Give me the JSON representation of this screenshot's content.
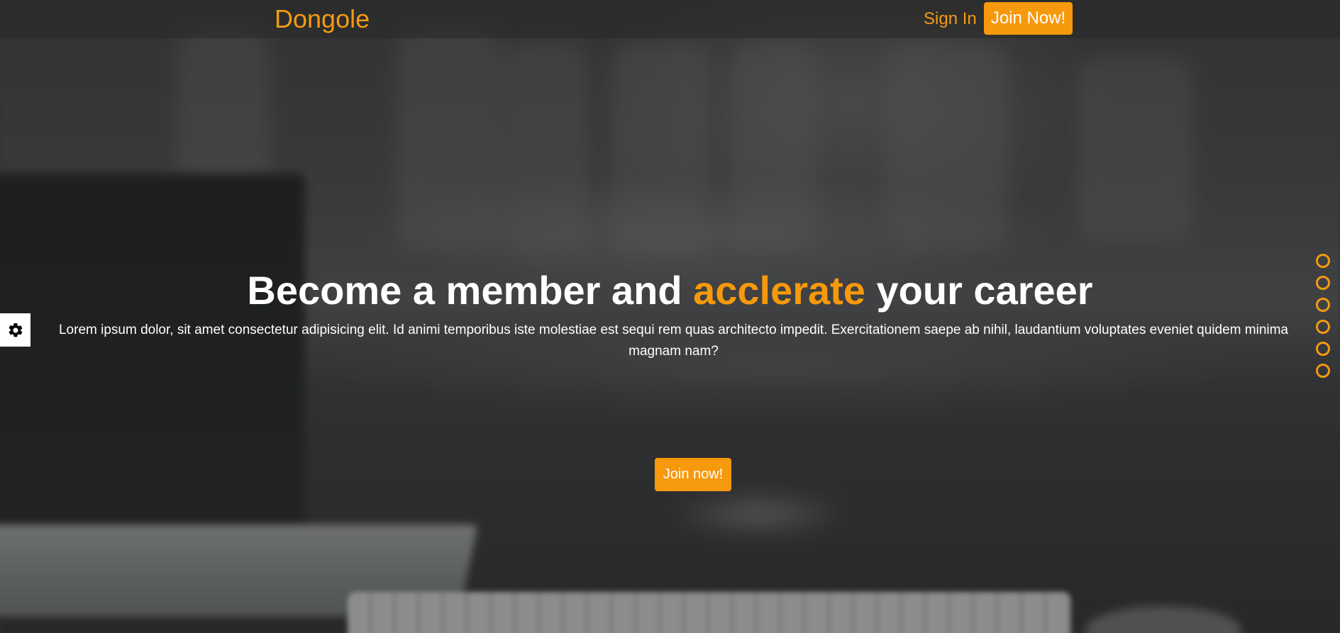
{
  "nav": {
    "brand": "Dongole",
    "sign_in_label": "Sign In",
    "join_label": "Join Now!"
  },
  "hero": {
    "headline_before": "Become a member and ",
    "headline_accent": "acclerate",
    "headline_after": " your career",
    "lead": "Lorem ipsum dolor, sit amet consectetur adipisicing elit. Id animi temporibus iste molestiae est sequi rem quas architecto impedit. Exercitationem saepe ab nihil, laudantium voluptates eveniet quidem minima magnam nam?",
    "cta_label": "Join now!"
  },
  "settings": {
    "icon": "gear-icon"
  },
  "slide_dots": {
    "count": 6
  },
  "colors": {
    "accent": "#f7990c",
    "brand": "#f39a12",
    "text": "#ffffff"
  }
}
